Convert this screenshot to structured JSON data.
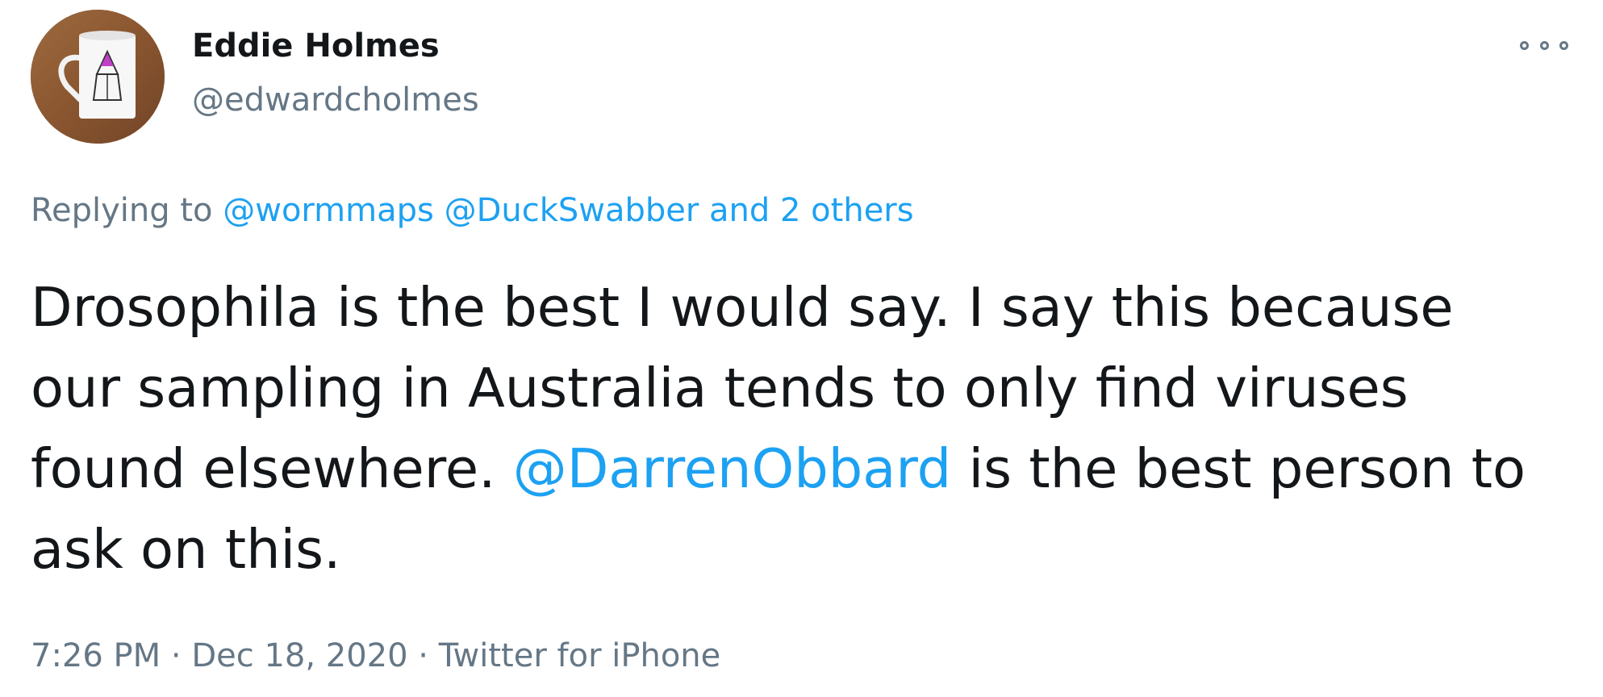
{
  "author": {
    "display_name": "Eddie Holmes",
    "handle": "@edwardcholmes",
    "avatar_icon": "mug-avatar-icon"
  },
  "menu": {
    "icon": "more-options-icon"
  },
  "reply_context": {
    "prefix": "Replying to",
    "mentions": [
      "@wormmaps",
      "@DuckSwabber"
    ],
    "others": "and 2 others"
  },
  "body": {
    "line1": "Drosophila is the best I would say. I say this because",
    "line2": "our sampling in Australia tends to only find viruses",
    "line3_before": "found elsewhere.",
    "line3_mention": "@DarrenObbard",
    "line3_after": "is the best person to",
    "line4": "ask on this."
  },
  "meta": {
    "time": "7:26 PM",
    "separator": "·",
    "date": "Dec 18, 2020",
    "source": "Twitter for iPhone"
  },
  "colors": {
    "link": "#1da1f2",
    "secondary_text": "#657786",
    "primary_text": "#14171a"
  }
}
